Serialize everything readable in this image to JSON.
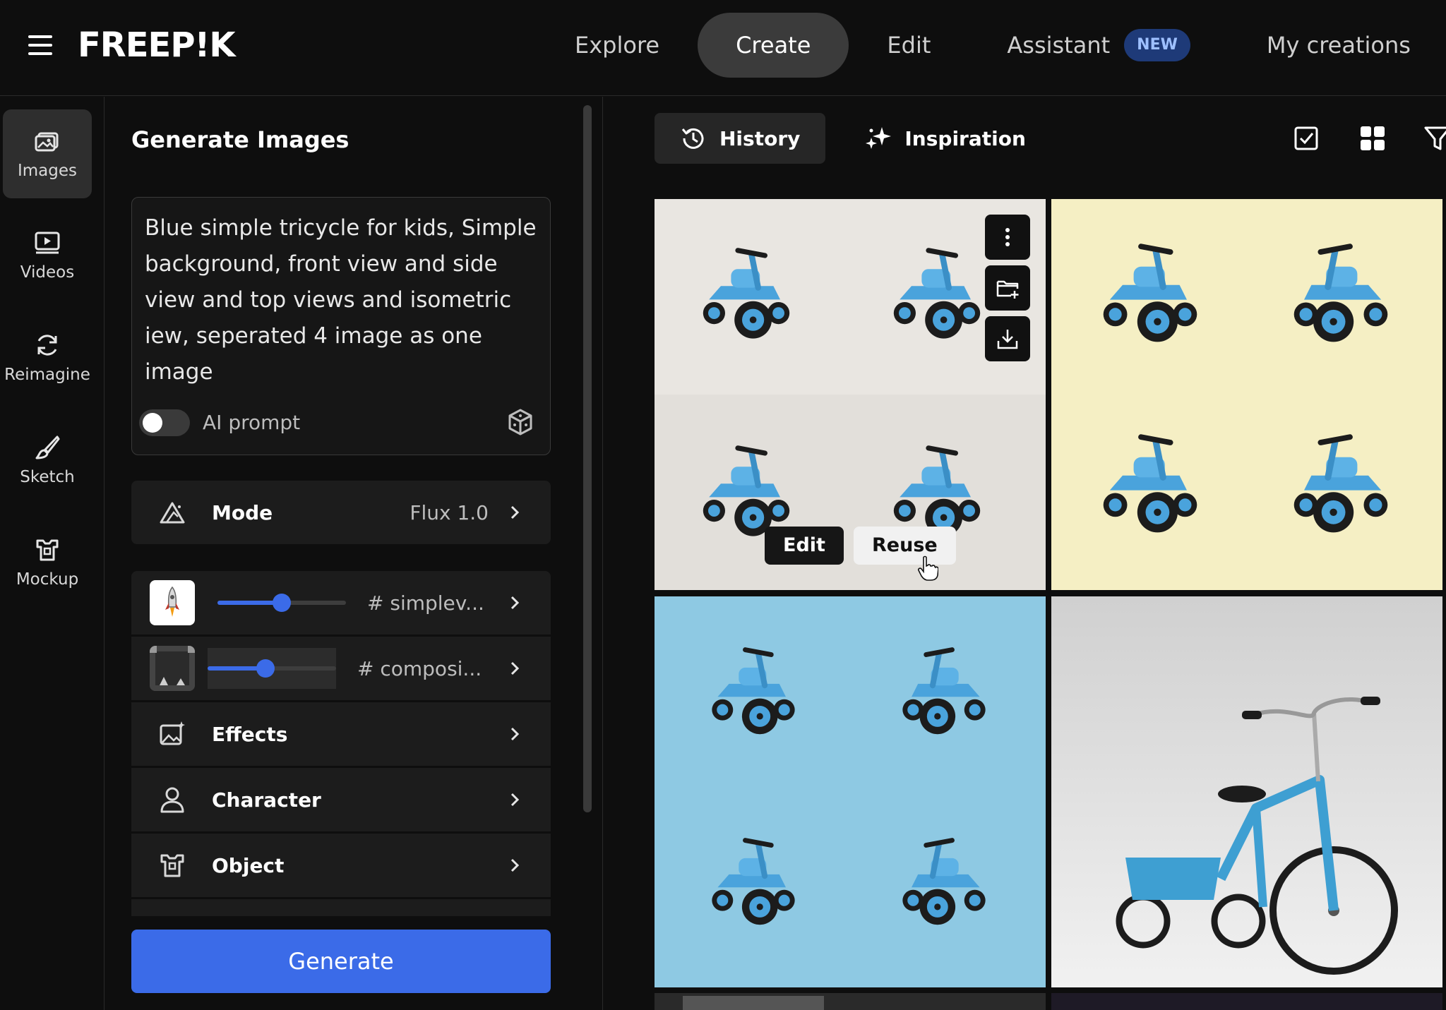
{
  "app": {
    "logo": "FREEP!K"
  },
  "nav": {
    "items": [
      {
        "label": "Explore",
        "active": false
      },
      {
        "label": "Create",
        "active": true
      },
      {
        "label": "Edit",
        "active": false
      },
      {
        "label": "Assistant",
        "active": false,
        "badge": "NEW"
      },
      {
        "label": "My creations",
        "active": false
      }
    ]
  },
  "rail": {
    "items": [
      {
        "label": "Images",
        "icon": "images-icon",
        "active": true
      },
      {
        "label": "Videos",
        "icon": "video-icon",
        "active": false
      },
      {
        "label": "Reimagine",
        "icon": "refresh-icon",
        "active": false
      },
      {
        "label": "Sketch",
        "icon": "brush-icon",
        "active": false
      },
      {
        "label": "Mockup",
        "icon": "mockup-icon",
        "active": false
      }
    ]
  },
  "panel": {
    "title": "Generate Images",
    "prompt": "Blue simple tricycle for kids, Simple background, front view and side view and top views and isometric iew, seperated 4 image as one image",
    "ai_prompt_label": "AI prompt",
    "ai_prompt_enabled": false,
    "mode": {
      "label": "Mode",
      "value": "Flux 1.0"
    },
    "styles": [
      {
        "tag": "# simplev...",
        "strength": 0.5,
        "thumb": "rocket-thumb"
      },
      {
        "tag": "# composi...",
        "strength": 0.45,
        "thumb": "composition-thumb"
      }
    ],
    "options": [
      {
        "label": "Effects",
        "icon": "effects-icon"
      },
      {
        "label": "Character",
        "icon": "person-icon"
      },
      {
        "label": "Object",
        "icon": "object-icon"
      }
    ],
    "generate_label": "Generate"
  },
  "gallery": {
    "tabs": [
      {
        "label": "History",
        "icon": "history-icon",
        "active": true
      },
      {
        "label": "Inspiration",
        "icon": "sparkle-icon",
        "active": false
      }
    ],
    "hover_actions": {
      "edit_label": "Edit",
      "reuse_label": "Reuse"
    },
    "colors": {
      "accent": "#3b6be8",
      "trike_blue": "#4aa3dc"
    }
  }
}
